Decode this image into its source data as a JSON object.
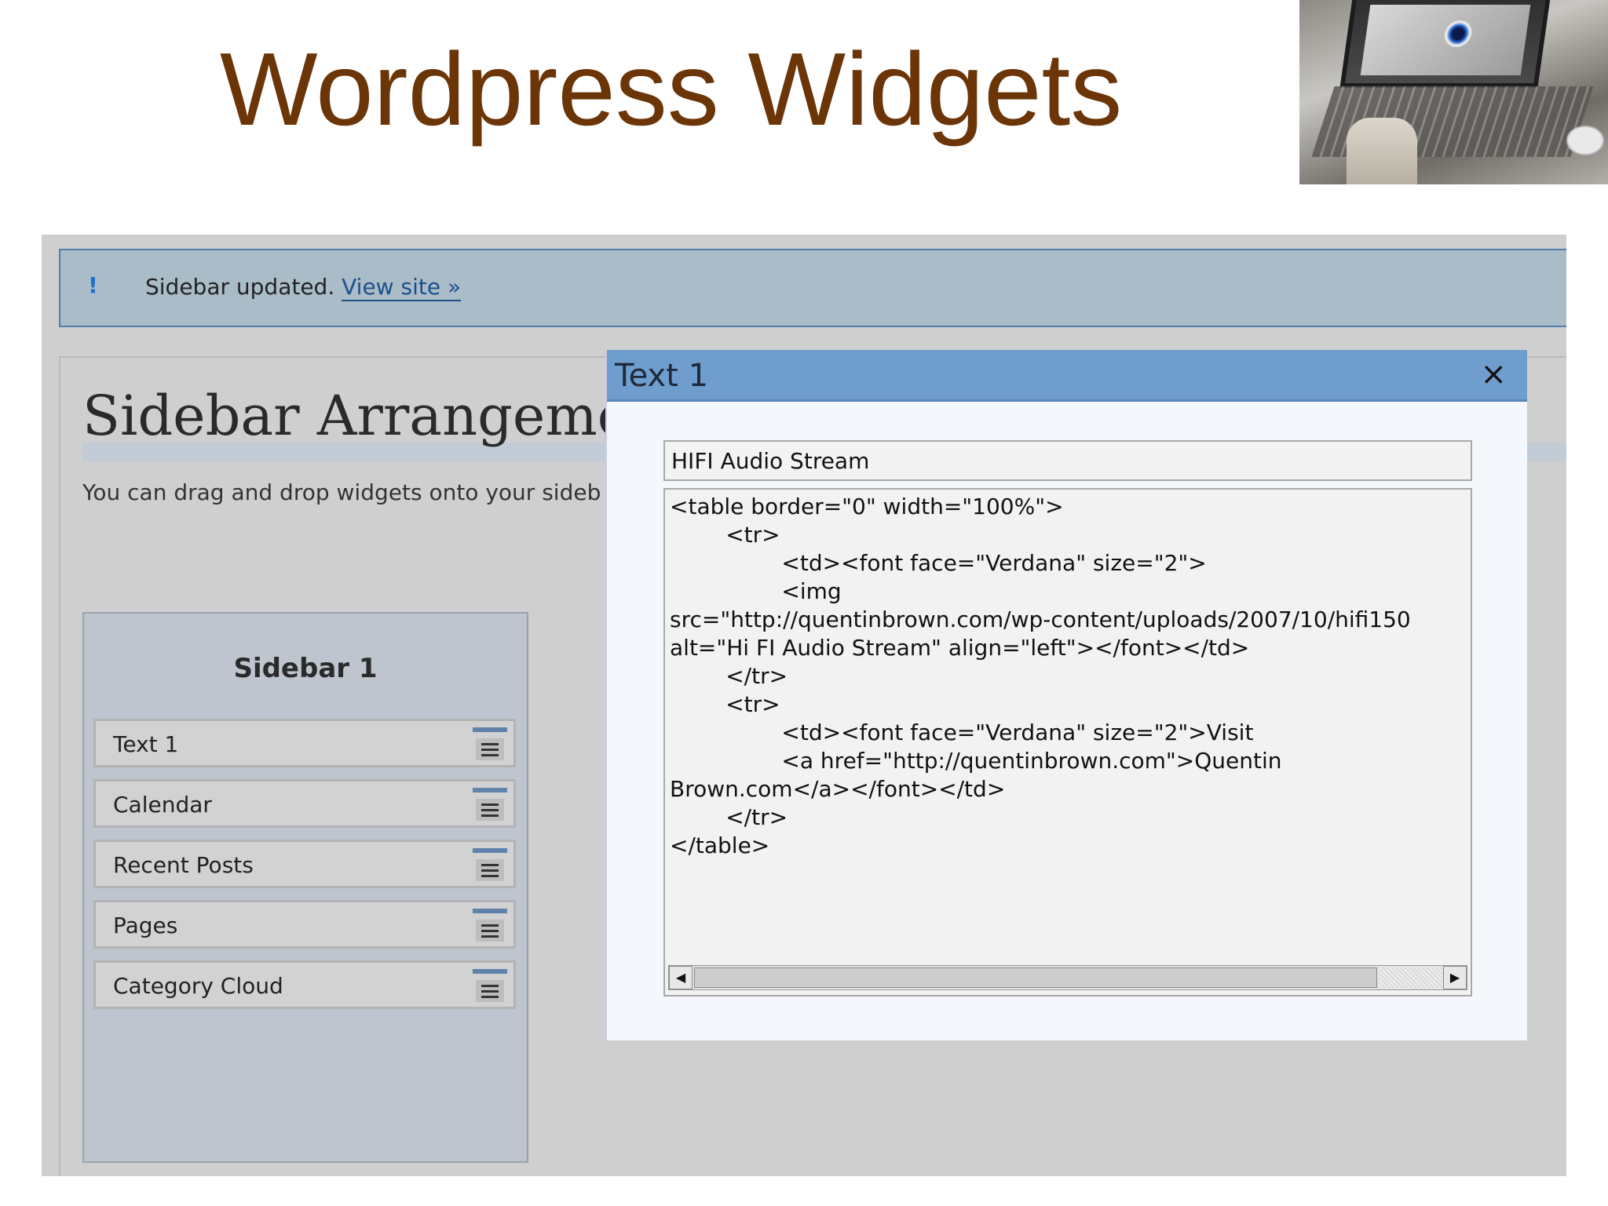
{
  "slide": {
    "title": "Wordpress Widgets"
  },
  "notice": {
    "icon": "!",
    "text": "Sidebar updated.",
    "link": "View site »"
  },
  "page": {
    "heading": "Sidebar Arrangement",
    "intro": "You can drag and drop widgets onto your sideb"
  },
  "sidebar": {
    "title": "Sidebar 1",
    "widgets": [
      {
        "label": "Text 1"
      },
      {
        "label": "Calendar"
      },
      {
        "label": "Recent Posts"
      },
      {
        "label": "Pages"
      },
      {
        "label": "Category Cloud"
      }
    ]
  },
  "dialog": {
    "title": "Text 1",
    "close": "×",
    "title_field_value": "HIFI Audio Stream",
    "code_lines": [
      "<table border=\"0\" width=\"100%\">",
      "        <tr>",
      "                <td><font face=\"Verdana\" size=\"2\">",
      "                <img",
      "src=\"http://quentinbrown.com/wp-content/uploads/2007/10/hifi150",
      "alt=\"Hi FI Audio Stream\" align=\"left\"></font></td>",
      "        </tr>",
      "        <tr>",
      "                <td><font face=\"Verdana\" size=\"2\">Visit",
      "                <a href=\"http://quentinbrown.com\">Quentin",
      "Brown.com</a></font></td>",
      "        </tr>",
      "</table>"
    ],
    "scroll_left": "◀",
    "scroll_right": "▶"
  },
  "icons": {
    "notice": "exclamation-icon",
    "close": "close-icon",
    "widget_handle": "drag-handle-icon"
  },
  "colors": {
    "title": "#6b3508",
    "notice_bg": "#a9bcc8",
    "dialog_titlebar": "#6f9dce"
  }
}
